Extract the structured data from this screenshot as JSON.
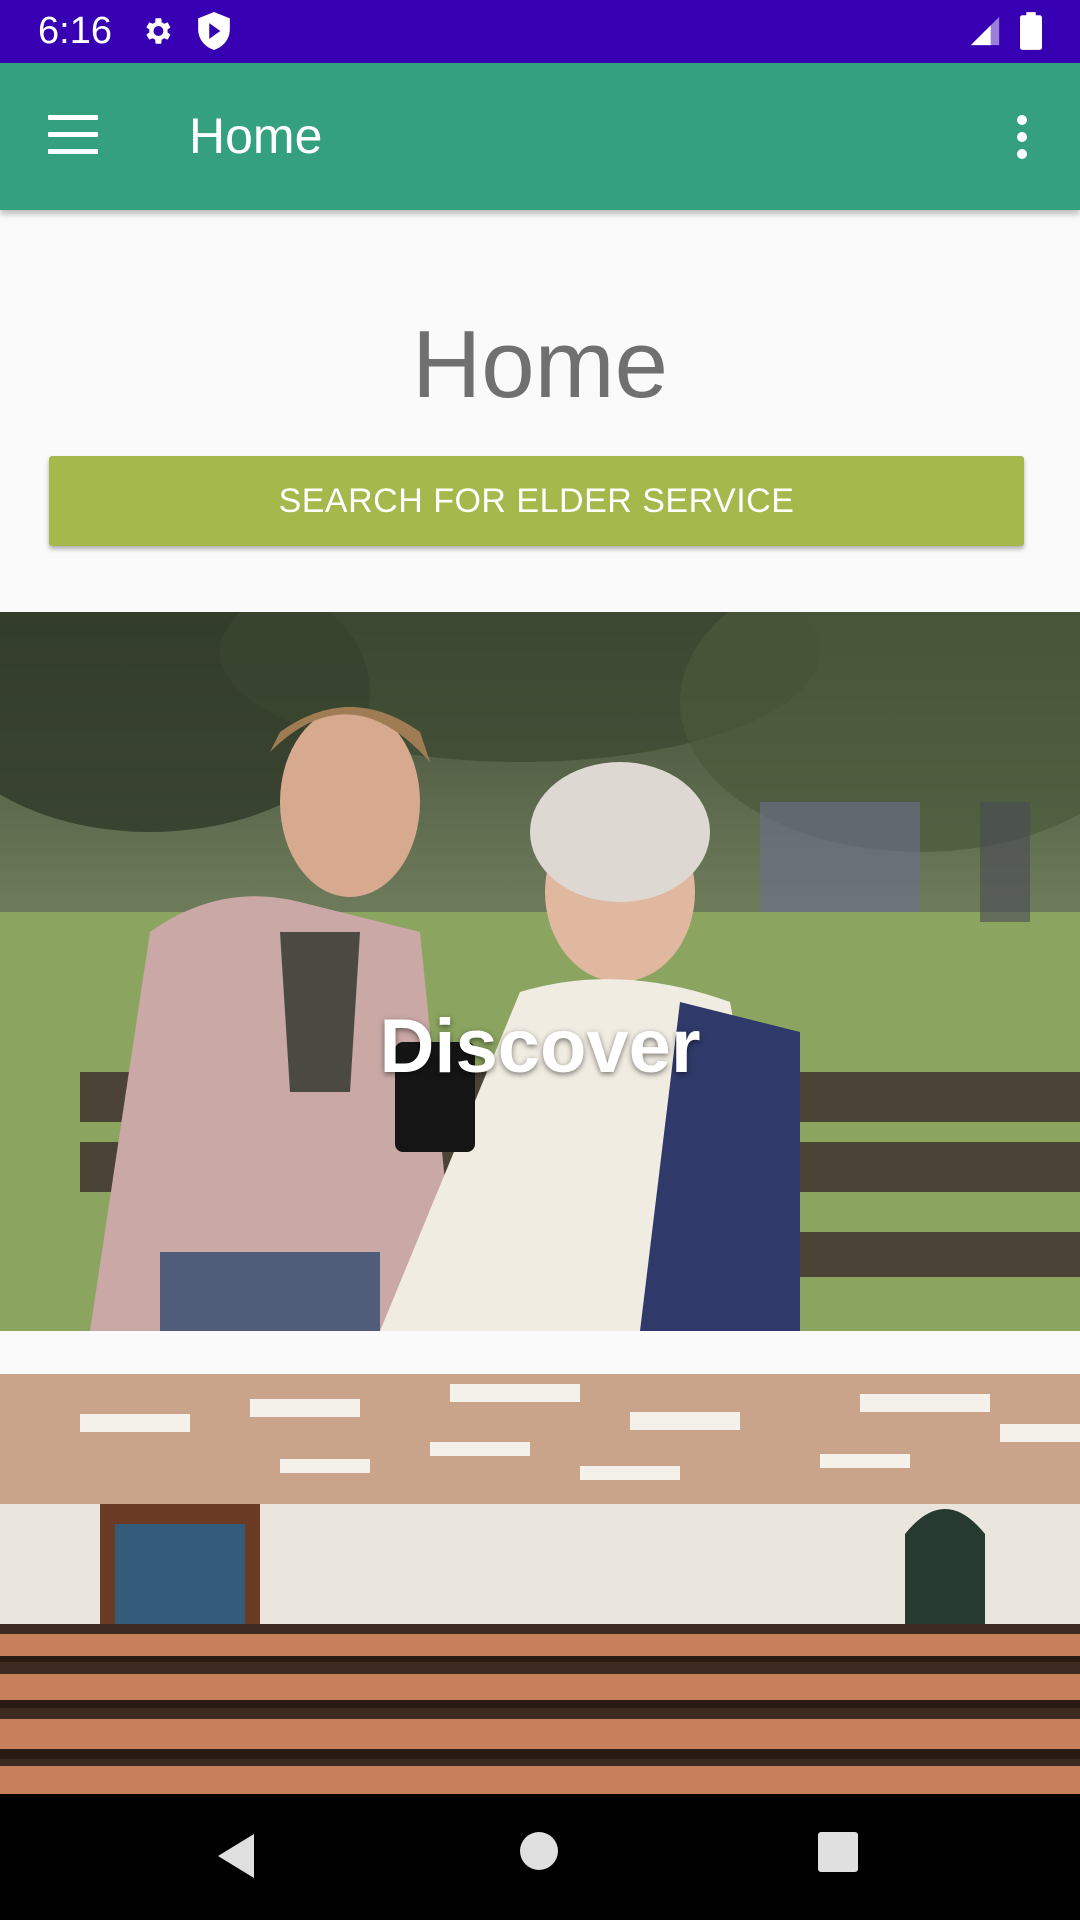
{
  "status_bar": {
    "time": "6:16",
    "icons": [
      "gear-icon",
      "shield-icon",
      "signal-icon",
      "battery-icon"
    ]
  },
  "app_bar": {
    "title": "Home",
    "background_color": "#35a07d",
    "menu_icon": "menu-icon",
    "overflow_icon": "more-vert-icon"
  },
  "main": {
    "heading": "Home",
    "search_button_label": "SEARCH FOR ELDER SERVICE",
    "search_button_color": "#a4b84c",
    "cards": [
      {
        "label": "Discover",
        "image": "young woman and elderly woman on park bench looking at phone"
      },
      {
        "label": "",
        "image": "empty lecture hall with wooden seats"
      }
    ]
  },
  "nav_bar": {
    "icons": [
      "back-icon",
      "home-icon",
      "recents-icon"
    ]
  },
  "colors": {
    "status_bar": "#3700b3",
    "app_bar": "#35a07d",
    "button": "#a4b84c",
    "background": "#fafafa"
  }
}
